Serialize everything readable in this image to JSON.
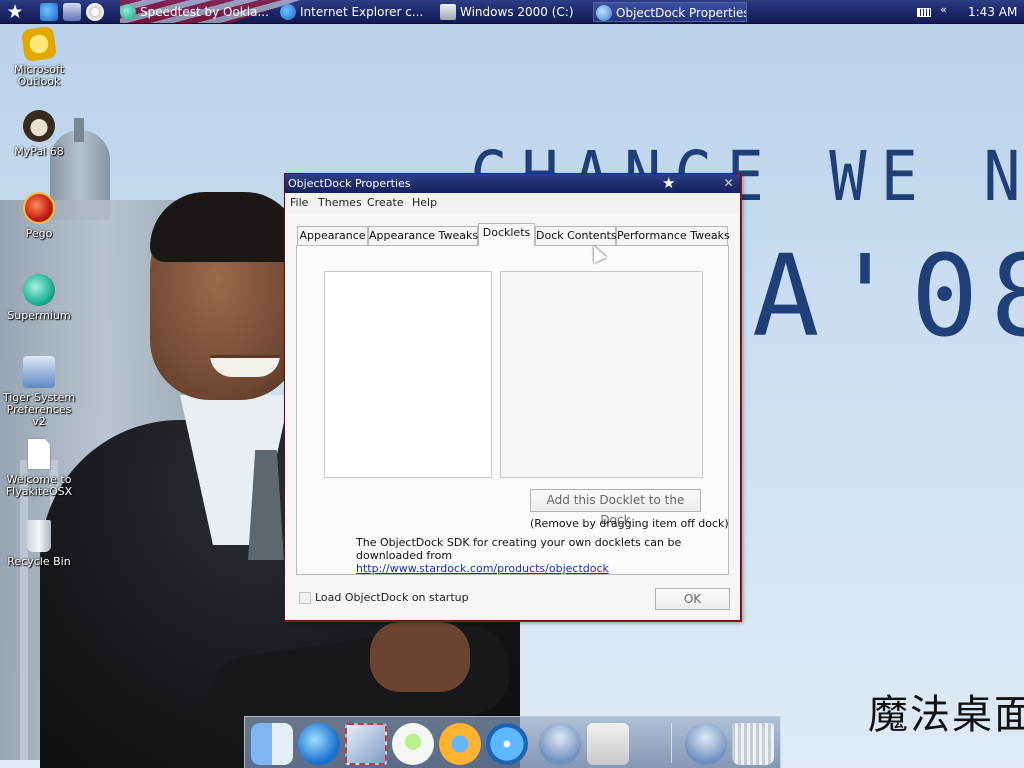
{
  "menubar": {
    "tasks": [
      {
        "label": "Speedtest by Ookla...",
        "icon": "globe-icon"
      },
      {
        "label": "Internet Explorer c...",
        "icon": "internet-explorer-icon"
      },
      {
        "label": "Windows 2000 (C:)",
        "icon": "folder-window-icon"
      },
      {
        "label": "ObjectDock Properties",
        "icon": "objectdock-icon"
      }
    ],
    "clock": "1:43 AM"
  },
  "desktop_icons": [
    {
      "label": "Microsoft Outlook",
      "icon": "outlook-icon"
    },
    {
      "label": "MyPal 68",
      "icon": "mypal-icon"
    },
    {
      "label": "Pego",
      "icon": "pego-icon"
    },
    {
      "label": "Supermium",
      "icon": "supermium-icon"
    },
    {
      "label": "Tiger System Preferences v2",
      "icon": "system-preferences-icon"
    },
    {
      "label": "Welcome to FlyakiteOSX",
      "icon": "document-icon"
    },
    {
      "label": "Recycle Bin",
      "icon": "recycle-bin-icon"
    }
  ],
  "wallpaper": {
    "slogan": "CHANGE WE NEED",
    "slogan_year": "A'08",
    "calligraphy": "魔法桌面"
  },
  "dialog": {
    "title": "ObjectDock Properties",
    "menu": [
      "File",
      "Themes",
      "Create",
      "Help"
    ],
    "tabs": [
      "Appearance",
      "Appearance Tweaks",
      "Docklets",
      "Dock Contents",
      "Performance Tweaks"
    ],
    "selected_tab": "Docklets",
    "add_button": "Add this Docklet to the Dock",
    "remove_hint": "(Remove by dragging item off dock)",
    "sdk_text": "The ObjectDock SDK for creating your own docklets can be downloaded from",
    "sdk_link": "http://www.stardock.com/products/objectdock",
    "startup_label": "Load ObjectDock on startup",
    "startup_checked": false,
    "ok_button": "OK"
  },
  "dock": {
    "items": [
      "finder-icon",
      "internet-explorer-icon",
      "mail-icon",
      "itunes-icon",
      "quicktime-icon",
      "dvd-player-icon",
      "help-icon",
      "apple-icon",
      "help-icon",
      "trash-icon"
    ]
  },
  "colors": {
    "menubar": "#1b2668",
    "dialog_border": "#6b0d0d",
    "slogan": "#1f3f78",
    "link": "#1a2bb8"
  }
}
